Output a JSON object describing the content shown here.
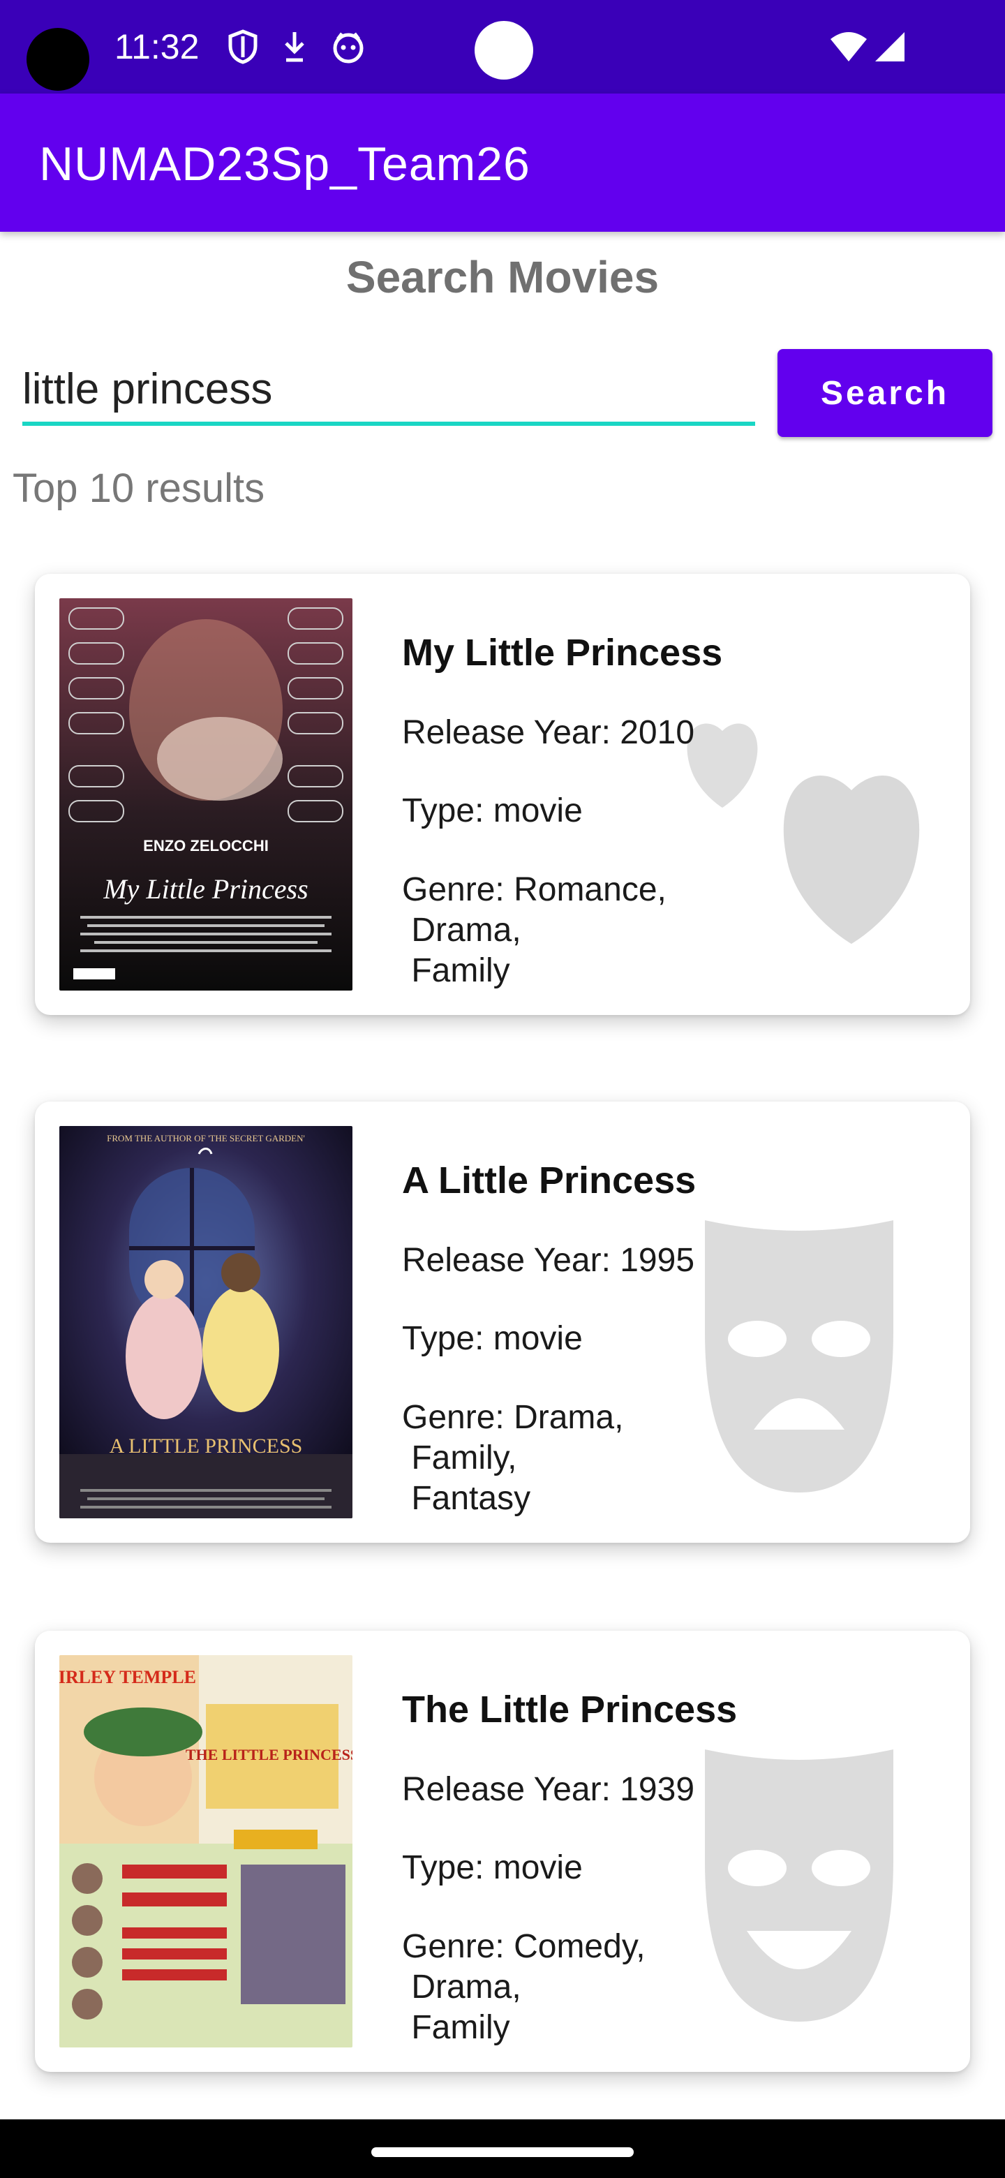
{
  "status_bar": {
    "time": "11:32",
    "icons": [
      "camera-cutout",
      "shield-icon",
      "download-icon",
      "face-icon",
      "notification-dot",
      "wifi-icon",
      "signal-icon"
    ]
  },
  "app_bar": {
    "title": "NUMAD23Sp_Team26"
  },
  "page": {
    "title": "Search Movies"
  },
  "search": {
    "value": "little princess",
    "button_label": "Search"
  },
  "results": {
    "label": "Top 10 results",
    "movies": [
      {
        "title": "My Little Princess",
        "year": "Release Year: 2010",
        "type": "Type: movie",
        "genre": "Genre: Romance,\n Drama,\n Family",
        "genre_icon": "heart-icon",
        "poster_text": "ENZO ZELOCCHI",
        "poster_title": "My Little Princess"
      },
      {
        "title": "A Little Princess",
        "year": "Release Year: 1995",
        "type": "Type: movie",
        "genre": "Genre: Drama,\n Family,\n Fantasy",
        "genre_icon": "sad-mask-icon",
        "poster_text": "FROM THE AUTHOR OF 'THE SECRET GARDEN'",
        "poster_title": "A LITTLE PRINCESS"
      },
      {
        "title": "The Little Princess",
        "year": "Release Year: 1939",
        "type": "Type: movie",
        "genre": "Genre: Comedy,\n Drama,\n Family",
        "genre_icon": "happy-mask-icon",
        "poster_text": "SHIRLEY TEMPLE",
        "poster_title": "THE LITTLE PRINCESS"
      }
    ]
  },
  "colors": {
    "status_bar": "#3a00b8",
    "primary": "#6200ee",
    "input_underline": "#1ad6c4",
    "icon_watermark": "#d9d9d9"
  }
}
